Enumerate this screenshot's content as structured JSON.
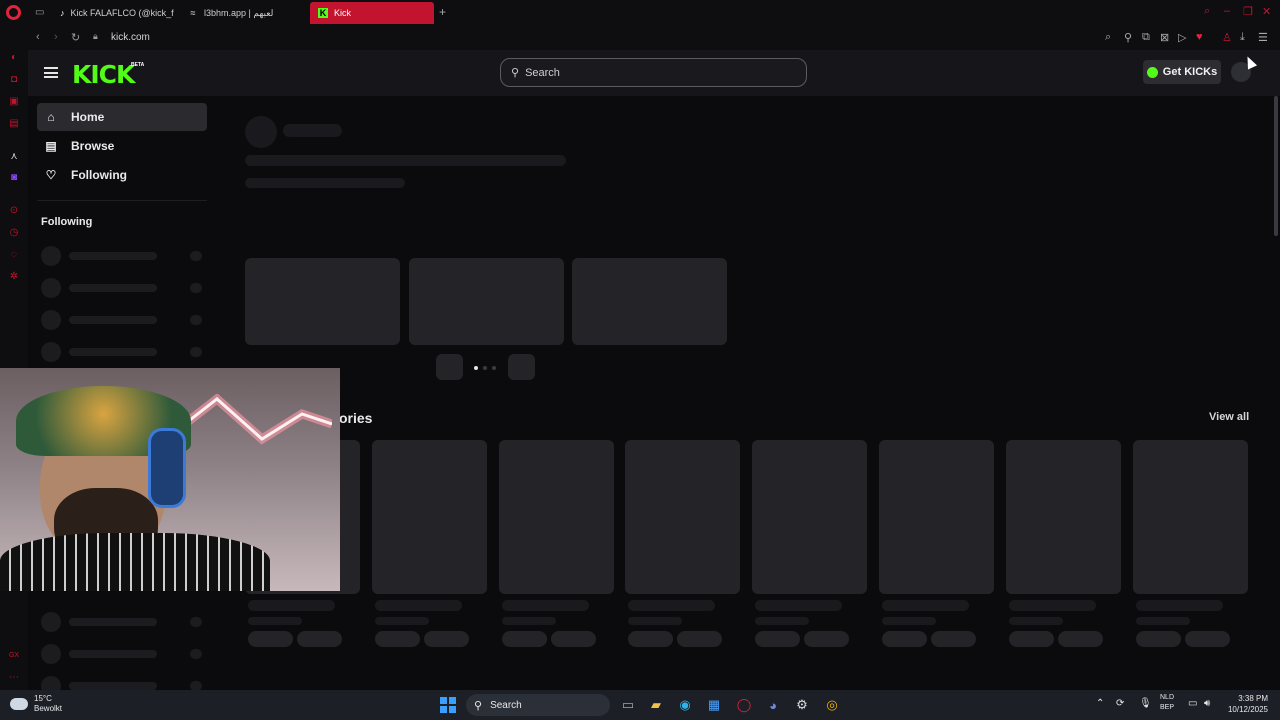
{
  "browser": {
    "tabs": [
      {
        "title": "Kick FALAFLCO (@kick_fa",
        "icon": "tiktok-icon"
      },
      {
        "title": "l3bhm.app | لعبهم",
        "icon": "app-icon"
      },
      {
        "title": "Kick",
        "icon": "kick-icon",
        "active": true
      }
    ],
    "new_tab_label": "+",
    "url": "kick.com"
  },
  "kick": {
    "logo": "KICK",
    "logo_badge": "BETA",
    "search_placeholder": "Search",
    "get_kicks_label": "Get KICKs",
    "nav": {
      "home": "Home",
      "browse": "Browse",
      "following": "Following"
    },
    "following_heading": "Following",
    "categories_heading": "ories",
    "view_all": "View all"
  },
  "taskbar": {
    "weather_temp": "15°C",
    "weather_desc": "Bewolkt",
    "search_label": "Search",
    "lang_line1": "NLD",
    "lang_line2": "BEP",
    "time": "3:38 PM",
    "date": "10/12/2025"
  },
  "colors": {
    "kick_green": "#53fc18",
    "opera_red": "#c3142f",
    "skeleton": "#242428"
  }
}
